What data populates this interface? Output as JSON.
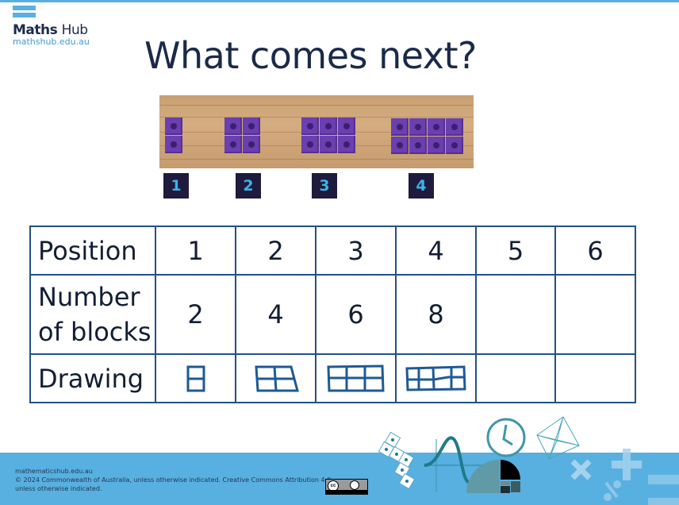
{
  "branding": {
    "logo_name_bold": "Maths",
    "logo_name_light": "Hub",
    "logo_url": "mathshub.edu.au"
  },
  "slide": {
    "title": "What comes next?",
    "photo": {
      "description": "purple connecting cubes arranged in growing pattern",
      "cube_color": "#6b3fb0",
      "groups": [
        {
          "label": "1",
          "columns": 1,
          "rows": 2
        },
        {
          "label": "2",
          "columns": 2,
          "rows": 2
        },
        {
          "label": "3",
          "columns": 3,
          "rows": 2
        },
        {
          "label": "4",
          "columns": 4,
          "rows": 2
        }
      ]
    },
    "label_colors": {
      "background": "#1e1b3d",
      "text": "#3ab3ea"
    }
  },
  "table": {
    "rows": [
      {
        "header": "Position",
        "cells": [
          "1",
          "2",
          "3",
          "4",
          "5",
          "6"
        ]
      },
      {
        "header_line1": "Number",
        "header_line2": "of blocks",
        "cells": [
          "2",
          "4",
          "6",
          "8",
          "",
          ""
        ]
      },
      {
        "header": "Drawing",
        "cells": [
          "drawing-1x2",
          "drawing-2x2",
          "drawing-3x2",
          "drawing-4x2",
          "",
          ""
        ]
      }
    ],
    "border_color": "#23508a"
  },
  "footer": {
    "line1": "mathematicshub.edu.au",
    "line2": "© 2024 Commonwealth of Australia, unless otherwise indicated. Creative Commons Attribution 4.0,",
    "line3": "unless otherwise indicated.",
    "license_badge": "cc-by-icon",
    "background": "#58b0e0",
    "decorations": [
      "cube-net-icon",
      "wave-graph-icon",
      "clock-icon",
      "octahedron-icon",
      "golden-spiral-icon",
      "multiply-icon",
      "plus-icon",
      "percent-icon",
      "minus-icon"
    ]
  }
}
